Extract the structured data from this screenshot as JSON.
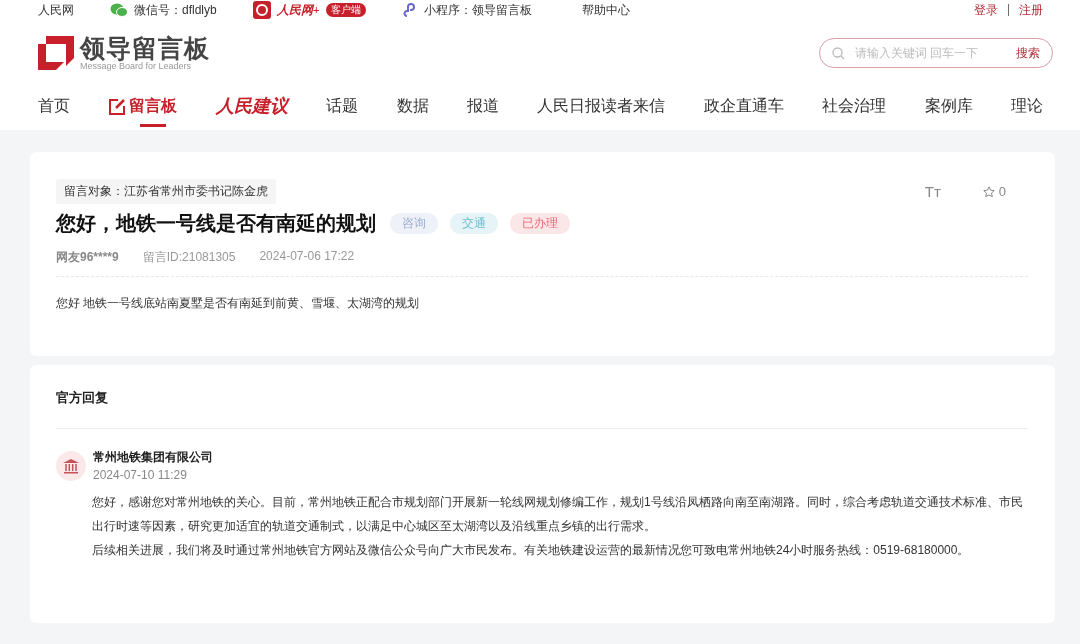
{
  "top_bar": {
    "site": "人民网",
    "wechat": "微信号：dfldlyb",
    "app_brand": "人民网+",
    "app_badge": "客户端",
    "mini_program": "小程序：领导留言板",
    "help": "帮助中心",
    "login": "登录",
    "separator": "|",
    "register": "注册"
  },
  "logo": {
    "title": "领导留言板",
    "subtitle": "Message Board for Leaders"
  },
  "search": {
    "placeholder": "请输入关键词 回车一下",
    "button": "搜索"
  },
  "nav": [
    {
      "label": "首页",
      "kind": "text",
      "selected": false
    },
    {
      "label": "留言板",
      "kind": "icon",
      "selected": true
    },
    {
      "label": "人民建议",
      "kind": "brand",
      "selected": false
    },
    {
      "label": "话题",
      "kind": "text",
      "selected": false
    },
    {
      "label": "数据",
      "kind": "text",
      "selected": false
    },
    {
      "label": "报道",
      "kind": "text",
      "selected": false
    },
    {
      "label": "人民日报读者来信",
      "kind": "text",
      "selected": false
    },
    {
      "label": "政企直通车",
      "kind": "text",
      "selected": false
    },
    {
      "label": "社会治理",
      "kind": "text",
      "selected": false
    },
    {
      "label": "案例库",
      "kind": "text",
      "selected": false
    },
    {
      "label": "理论",
      "kind": "text",
      "selected": false
    }
  ],
  "message": {
    "target": "留言对象：江苏省常州市委书记陈金虎",
    "font_toggle": "Tт",
    "favorites": "0",
    "title": "您好，地铁一号线是否有南延的规划",
    "tags": [
      {
        "label": "咨询",
        "color": "#eef1f7"
      },
      {
        "label": "交通",
        "color": "#e6f4f7"
      },
      {
        "label": "已办理",
        "color": "#fbe6e8"
      }
    ],
    "author": "网友96****9",
    "id": "留言ID:21081305",
    "time": "2024-07-06 17:22",
    "body": "您好 地铁一号线底站南夏墅是否有南延到前黄、雪堰、太湖湾的规划"
  },
  "reply": {
    "heading": "官方回复",
    "org": "常州地铁集团有限公司",
    "time": "2024-07-10 11:29",
    "paragraphs": [
      "您好，感谢您对常州地铁的关心。目前，常州地铁正配合市规划部门开展新一轮线网规划修编工作，规划1号线沿凤栖路向南至南湖路。同时，综合考虑轨道交通技术标准、市民出行时速等因素，研究更加适宜的轨道交通制式，以满足中心城区至太湖湾以及沿线重点乡镇的出行需求。",
      "后续相关进展，我们将及时通过常州地铁官方网站及微信公众号向广大市民发布。有关地铁建设运营的最新情况您可致电常州地铁24小时服务热线：0519-68180000。"
    ]
  }
}
